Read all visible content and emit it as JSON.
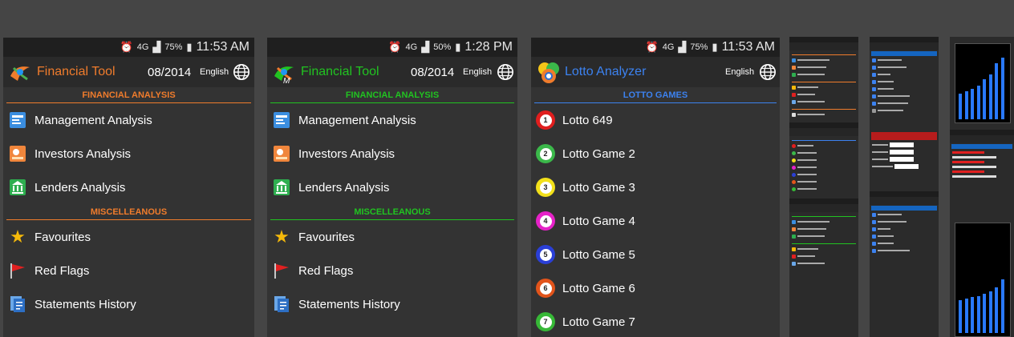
{
  "screen1": {
    "status": {
      "time": "11:53 AM",
      "battery": "75%",
      "network": "4G"
    },
    "title": "Financial Tool",
    "date": "08/2014",
    "language": "English",
    "sections": [
      {
        "label": "FINANCIAL ANALYSIS",
        "items": [
          "Management Analysis",
          "Investors Analysis",
          "Lenders Analysis"
        ]
      },
      {
        "label": "MISCELLEANOUS",
        "items": [
          "Favourites",
          "Red Flags",
          "Statements History"
        ]
      }
    ],
    "accent": "#f07c2c"
  },
  "screen2": {
    "status": {
      "time": "1:28 PM",
      "battery": "50%",
      "network": "4G"
    },
    "title": "Financial Tool",
    "date": "08/2014",
    "language": "English",
    "sections": [
      {
        "label": "FINANCIAL ANALYSIS",
        "items": [
          "Management Analysis",
          "Investors Analysis",
          "Lenders Analysis"
        ]
      },
      {
        "label": "MISCELLEANOUS",
        "items": [
          "Favourites",
          "Red Flags",
          "Statements History"
        ]
      }
    ],
    "accent": "#21c321"
  },
  "screen3": {
    "status": {
      "time": "11:53 AM",
      "battery": "75%",
      "network": "4G"
    },
    "title": "Lotto Analyzer",
    "language": "English",
    "section": "LOTTO GAMES",
    "games": [
      {
        "label": "Lotto 649",
        "num": "1",
        "color": "#e01e1e"
      },
      {
        "label": "Lotto Game 2",
        "num": "2",
        "color": "#3bb84a"
      },
      {
        "label": "Lotto Game 3",
        "num": "3",
        "color": "#f2e01a"
      },
      {
        "label": "Lotto Game 4",
        "num": "4",
        "color": "#e622c8"
      },
      {
        "label": "Lotto Game 5",
        "num": "5",
        "color": "#2a3fd6"
      },
      {
        "label": "Lotto Game 6",
        "num": "6",
        "color": "#e2541b"
      },
      {
        "label": "Lotto Game 7",
        "num": "7",
        "color": "#37b837"
      }
    ],
    "accent": "#3c82f0"
  },
  "icons": {
    "management": "management-icon",
    "investors": "investors-icon",
    "lenders": "lenders-icon",
    "favourites": "star-icon",
    "redflags": "red-flag-icon",
    "history": "statements-history-icon"
  }
}
